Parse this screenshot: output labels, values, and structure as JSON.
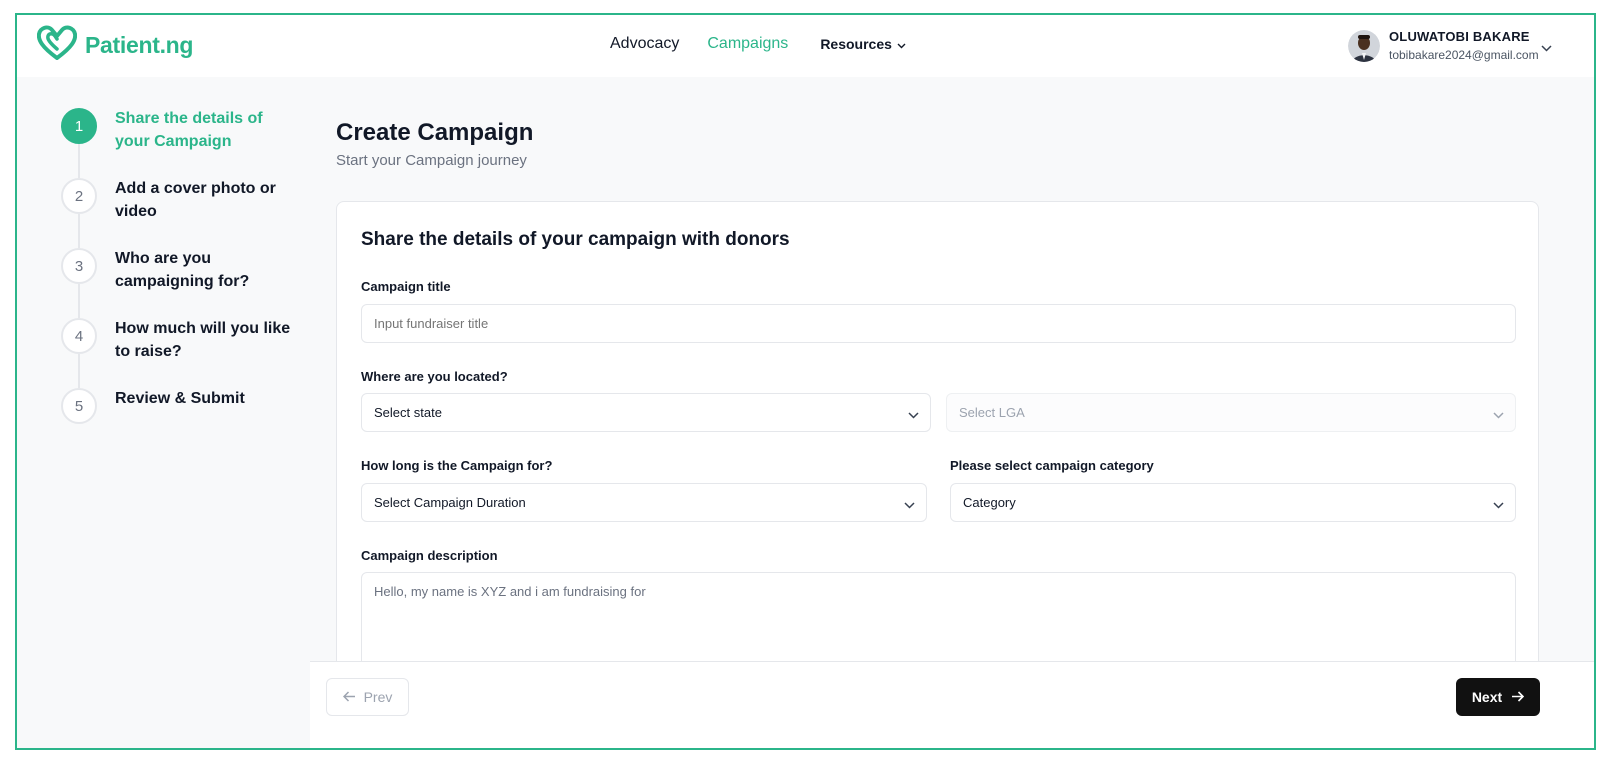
{
  "brand": {
    "name": "Patient.ng",
    "logo_icon": "heart-logo-icon",
    "accent_color": "#2bb58a"
  },
  "nav": {
    "items": [
      {
        "label": "Advocacy",
        "active": false
      },
      {
        "label": "Campaigns",
        "active": true
      }
    ],
    "resources_label": "Resources"
  },
  "user": {
    "name": "OLUWATOBI BAKARE",
    "email": "tobibakare2024@gmail.com"
  },
  "steps": [
    {
      "number": "1",
      "label": "Share the details of your Campaign",
      "active": true
    },
    {
      "number": "2",
      "label": "Add a cover photo or video",
      "active": false
    },
    {
      "number": "3",
      "label": "Who are you campaigning for?",
      "active": false
    },
    {
      "number": "4",
      "label": "How much will you like to raise?",
      "active": false
    },
    {
      "number": "5",
      "label": "Review & Submit",
      "active": false
    }
  ],
  "page": {
    "title": "Create Campaign",
    "subtitle": "Start your Campaign journey"
  },
  "form": {
    "section_title": "Share the details of your campaign with donors",
    "title_label": "Campaign title",
    "title_placeholder": "Input fundraiser title",
    "location_label": "Where are you located?",
    "state_select": "Select state",
    "lga_select": "Select LGA",
    "duration_label": "How long is the Campaign for?",
    "duration_select": "Select Campaign Duration",
    "category_label": "Please select campaign category",
    "category_select": "Category",
    "description_label": "Campaign description",
    "description_placeholder": "Hello, my name is XYZ and i am fundraising for"
  },
  "footer": {
    "prev_label": "Prev",
    "next_label": "Next"
  }
}
